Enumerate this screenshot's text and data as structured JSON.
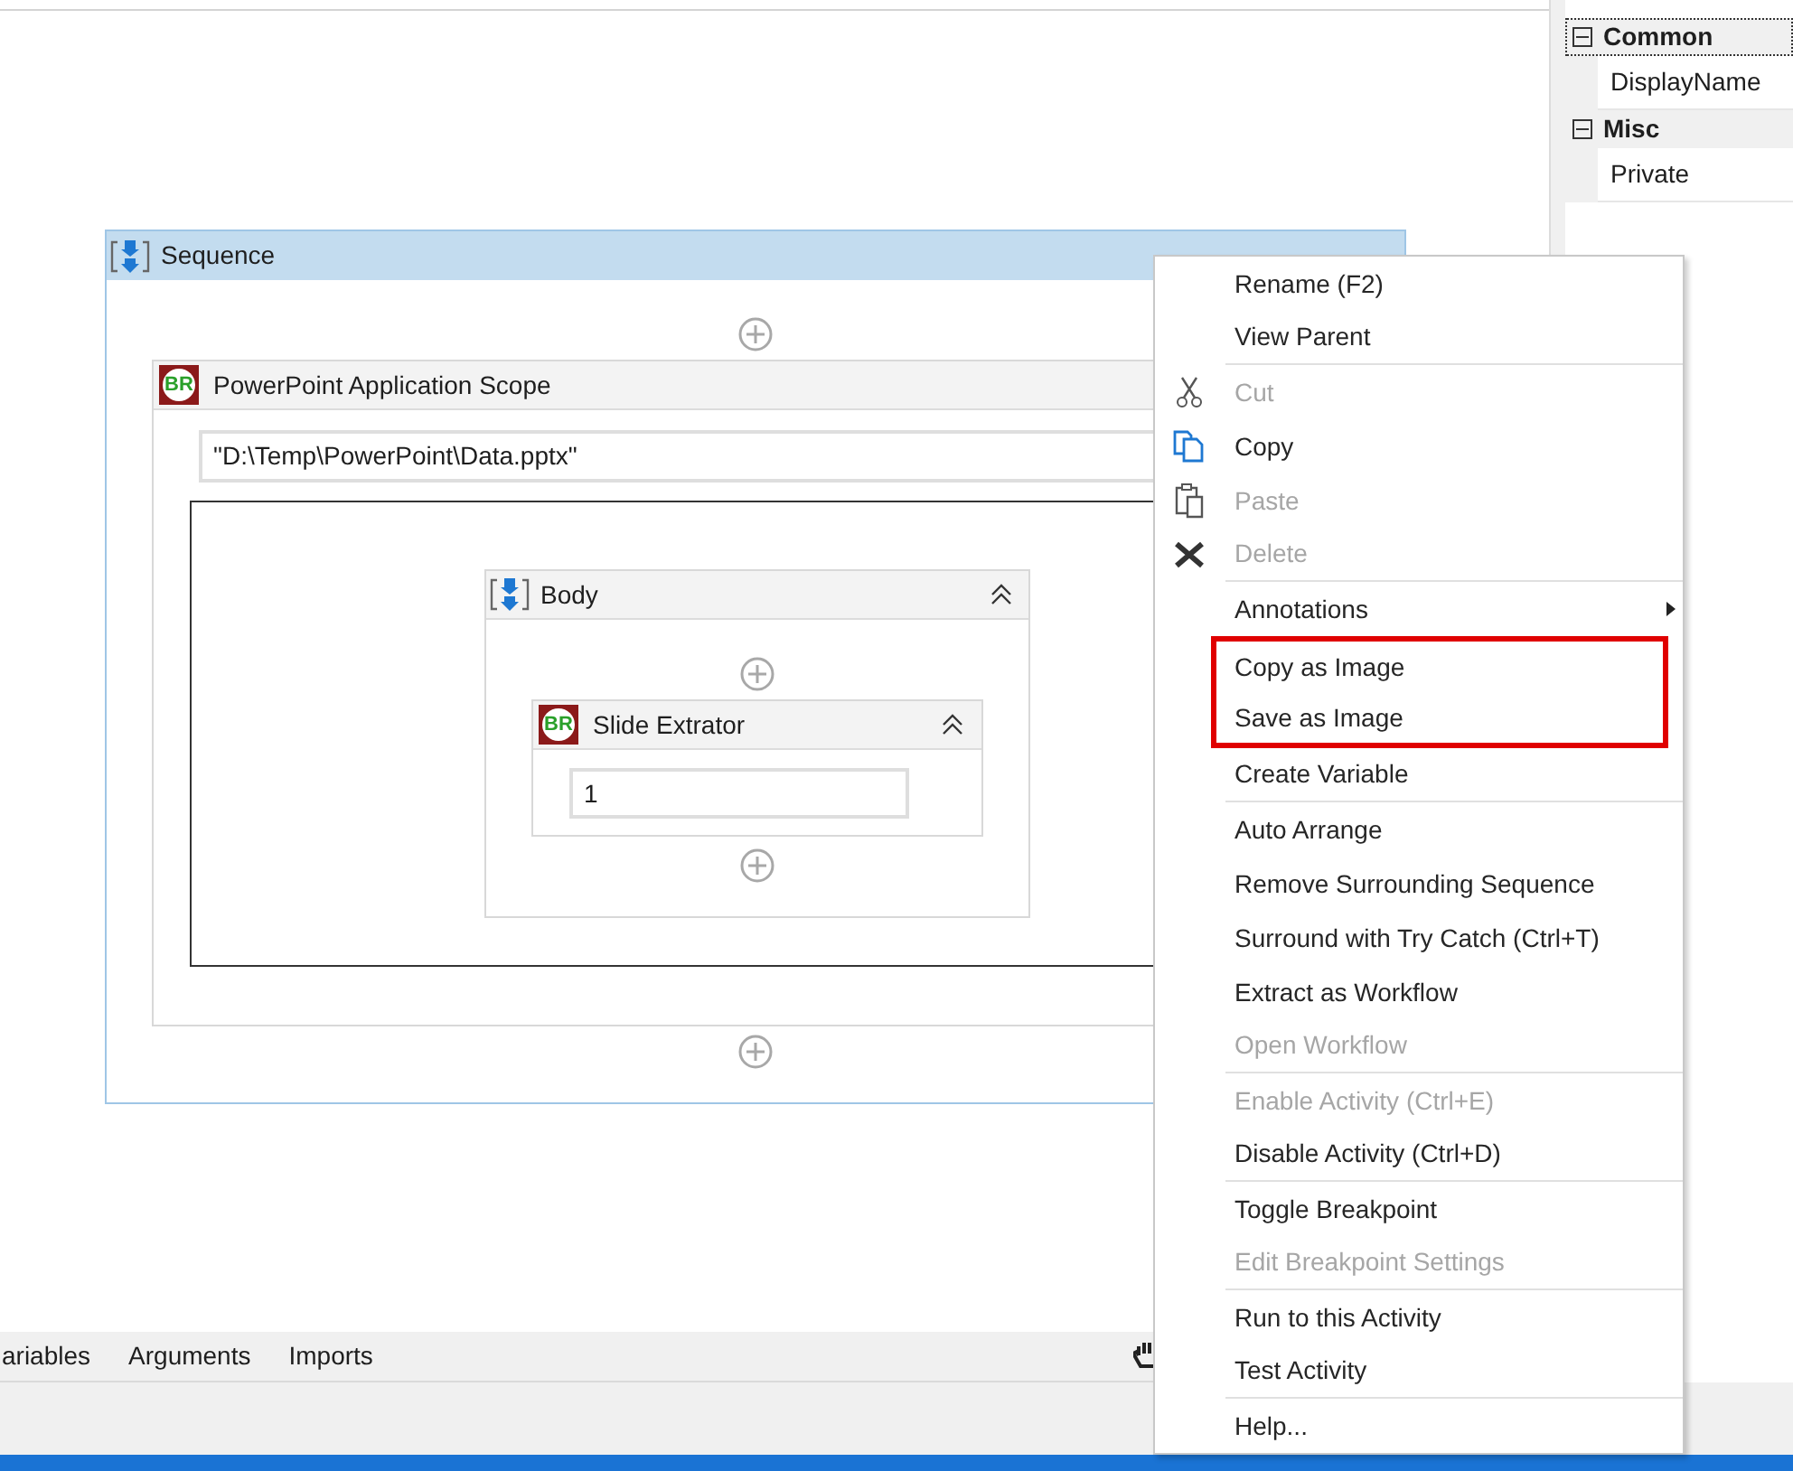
{
  "designer": {
    "sequence": {
      "title": "Sequence",
      "activity": {
        "title": "PowerPoint Application Scope",
        "badge": "BR",
        "path": "\"D:\\Temp\\PowerPoint\\Data.pptx\"",
        "body": {
          "title": "Body",
          "child": {
            "title": "Slide Extrator",
            "badge": "BR",
            "value": "1"
          }
        }
      }
    }
  },
  "properties": {
    "groups": [
      {
        "title": "Common",
        "expanded": true,
        "focused": true,
        "rows": [
          "DisplayName"
        ]
      },
      {
        "title": "Misc",
        "expanded": true,
        "focused": false,
        "rows": [
          "Private"
        ]
      }
    ]
  },
  "bottom_tabs": [
    "ariables",
    "Arguments",
    "Imports"
  ],
  "context_menu": {
    "items": [
      {
        "label": "Rename (F2)",
        "kind": "plain",
        "disabled": false,
        "separator_after": false,
        "highlighted": false
      },
      {
        "label": "View Parent",
        "kind": "plain",
        "disabled": false,
        "separator_after": true,
        "highlighted": false
      },
      {
        "label": "Cut",
        "kind": "cut",
        "disabled": true,
        "separator_after": false,
        "highlighted": false
      },
      {
        "label": "Copy",
        "kind": "copy",
        "disabled": false,
        "separator_after": false,
        "highlighted": false
      },
      {
        "label": "Paste",
        "kind": "paste",
        "disabled": true,
        "separator_after": false,
        "highlighted": false
      },
      {
        "label": "Delete",
        "kind": "delete",
        "disabled": true,
        "separator_after": true,
        "highlighted": false
      },
      {
        "label": "Annotations",
        "kind": "submenu",
        "disabled": false,
        "separator_after": false,
        "highlighted": false
      },
      {
        "label": "Copy as Image",
        "kind": "plain",
        "disabled": false,
        "separator_after": false,
        "highlighted": true
      },
      {
        "label": "Save as Image",
        "kind": "plain",
        "disabled": false,
        "separator_after": false,
        "highlighted": true
      },
      {
        "label": "Create Variable",
        "kind": "plain",
        "disabled": false,
        "separator_after": true,
        "highlighted": false
      },
      {
        "label": "Auto Arrange",
        "kind": "plain",
        "disabled": false,
        "separator_after": false,
        "highlighted": false
      },
      {
        "label": "Remove Surrounding Sequence",
        "kind": "plain",
        "disabled": false,
        "separator_after": false,
        "highlighted": false
      },
      {
        "label": "Surround with Try Catch (Ctrl+T)",
        "kind": "plain",
        "disabled": false,
        "separator_after": false,
        "highlighted": false
      },
      {
        "label": "Extract as Workflow",
        "kind": "plain",
        "disabled": false,
        "separator_after": false,
        "highlighted": false
      },
      {
        "label": "Open Workflow",
        "kind": "plain",
        "disabled": true,
        "separator_after": true,
        "highlighted": false
      },
      {
        "label": "Enable Activity (Ctrl+E)",
        "kind": "plain",
        "disabled": true,
        "separator_after": false,
        "highlighted": false
      },
      {
        "label": "Disable Activity (Ctrl+D)",
        "kind": "plain",
        "disabled": false,
        "separator_after": true,
        "highlighted": false
      },
      {
        "label": "Toggle Breakpoint",
        "kind": "plain",
        "disabled": false,
        "separator_after": false,
        "highlighted": false
      },
      {
        "label": "Edit Breakpoint Settings",
        "kind": "plain",
        "disabled": true,
        "separator_after": true,
        "highlighted": false
      },
      {
        "label": "Run to this Activity",
        "kind": "plain",
        "disabled": false,
        "separator_after": false,
        "highlighted": false
      },
      {
        "label": "Test Activity",
        "kind": "plain",
        "disabled": false,
        "separator_after": true,
        "highlighted": false
      },
      {
        "label": "Help...",
        "kind": "plain",
        "disabled": false,
        "separator_after": false,
        "highlighted": false
      }
    ]
  }
}
